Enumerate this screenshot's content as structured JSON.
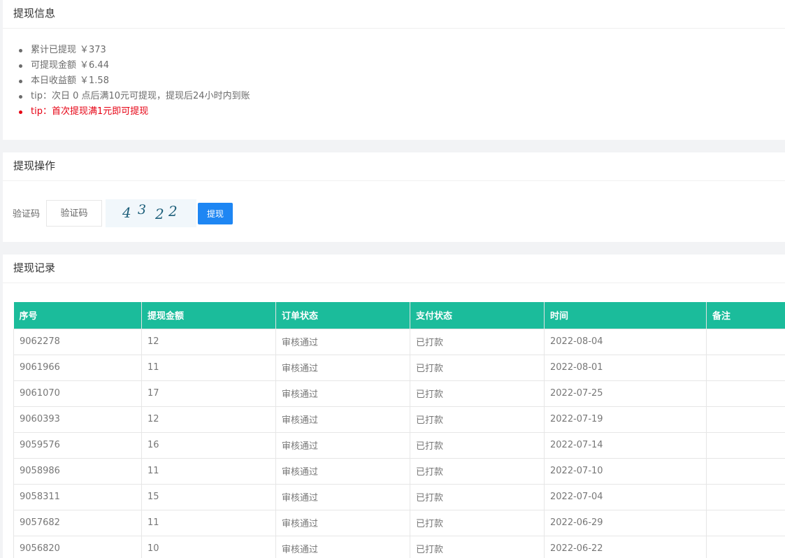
{
  "info": {
    "title": "提现信息",
    "items": [
      {
        "label": "累计已提现",
        "value": "￥373",
        "highlight": false
      },
      {
        "label": "可提现金额",
        "value": "￥6.44",
        "highlight": false
      },
      {
        "label": "本日收益额",
        "value": "￥1.58",
        "highlight": false
      },
      {
        "label": "tip：次日 0 点后满10元可提现，提现后24小时内到账",
        "value": "",
        "highlight": false
      },
      {
        "label": "tip：首次提现满1元即可提现",
        "value": "",
        "highlight": true
      }
    ]
  },
  "operation": {
    "title": "提现操作",
    "captcha_label": "验证码",
    "captcha_placeholder": "验证码",
    "captcha_text": [
      "4",
      "3",
      "2",
      "2"
    ],
    "submit_label": "提现",
    "button_color": "#1e86f3"
  },
  "records": {
    "title": "提现记录",
    "header_color": "#1bbc9b",
    "columns": [
      "序号",
      "提现金额",
      "订单状态",
      "支付状态",
      "时间",
      "备注"
    ],
    "rows": [
      [
        "9062278",
        "12",
        "审核通过",
        "已打款",
        "2022-08-04",
        ""
      ],
      [
        "9061966",
        "11",
        "审核通过",
        "已打款",
        "2022-08-01",
        ""
      ],
      [
        "9061070",
        "17",
        "审核通过",
        "已打款",
        "2022-07-25",
        ""
      ],
      [
        "9060393",
        "12",
        "审核通过",
        "已打款",
        "2022-07-19",
        ""
      ],
      [
        "9059576",
        "16",
        "审核通过",
        "已打款",
        "2022-07-14",
        ""
      ],
      [
        "9058986",
        "11",
        "审核通过",
        "已打款",
        "2022-07-10",
        ""
      ],
      [
        "9058311",
        "15",
        "审核通过",
        "已打款",
        "2022-07-04",
        ""
      ],
      [
        "9057682",
        "11",
        "审核通过",
        "已打款",
        "2022-06-29",
        ""
      ],
      [
        "9056820",
        "10",
        "审核通过",
        "已打款",
        "2022-06-22",
        ""
      ]
    ]
  }
}
